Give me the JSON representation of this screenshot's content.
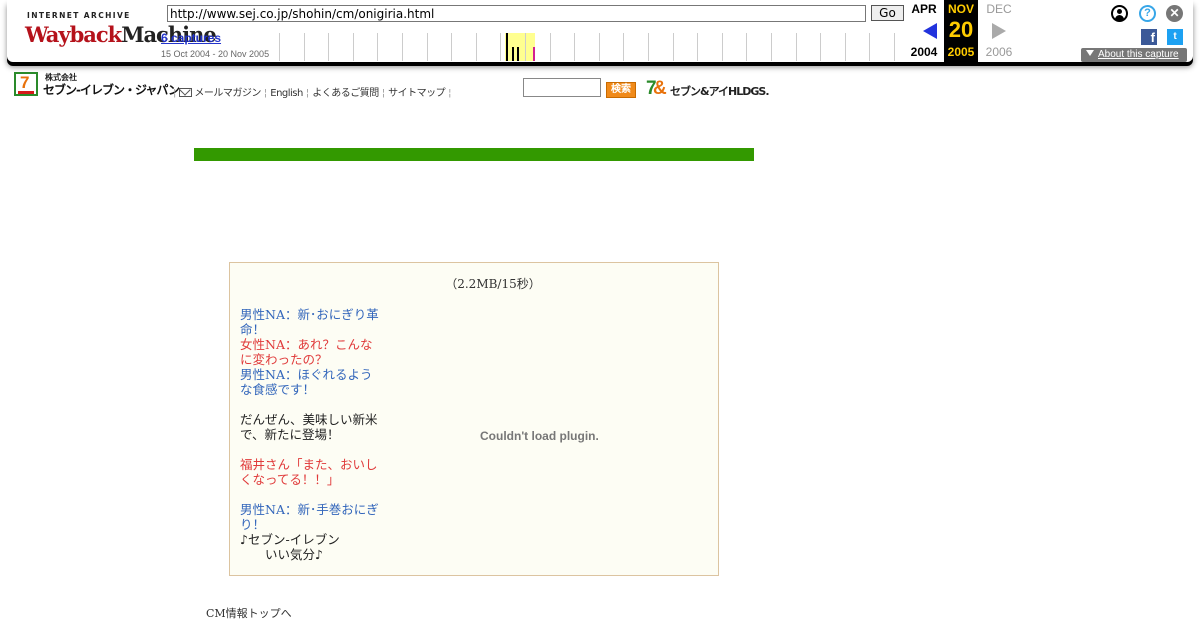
{
  "wayback": {
    "logo_top": "INTERNET ARCHIVE",
    "logo_word1": "Wayback",
    "logo_word2": "Machine",
    "url": "http://www.sej.co.jp/shohin/cm/onigiria.html",
    "go_label": "Go",
    "captures_label": "6 captures",
    "capture_range": "15 Oct 2004 - 20 Nov 2005",
    "prev_month": "APR",
    "prev_year": "2004",
    "cur_month": "NOV",
    "cur_day": "20",
    "cur_year": "2005",
    "next_month": "DEC",
    "next_year": "2006",
    "help_glyph": "?",
    "close_glyph": "✕",
    "facebook_glyph": "f",
    "twitter_glyph": "t",
    "about_label": "About this capture",
    "colors": {
      "accent": "#2233cc",
      "current_bg": "#000000",
      "current_fg": "#ffcc00"
    }
  },
  "site": {
    "logo_kk": "株式会社",
    "logo_name": "セブン-イレブン・ジャパン",
    "logo_seven": "7",
    "nav": [
      {
        "label": "メールマガジン"
      },
      {
        "label": "English"
      },
      {
        "label": "よくあるご質問"
      },
      {
        "label": "サイトマップ"
      }
    ],
    "search_placeholder": "",
    "search_button": "検索",
    "holdings_mark1": "7",
    "holdings_mark2": "&",
    "holdings_text": "セブン&アイHLDGS.",
    "colors": {
      "green": "#339900",
      "orange": "#f08a1a"
    }
  },
  "cm": {
    "size_note": "（2.2MB/15秒）",
    "script": [
      {
        "text": "男性NA：新･おにぎり革",
        "color": "blue"
      },
      {
        "text": "命！",
        "color": "blue"
      },
      {
        "text": "女性NA：あれ？こんな",
        "color": "red"
      },
      {
        "text": "に変わったの？",
        "color": "red"
      },
      {
        "text": "男性NA：ほぐれるよう",
        "color": "blue"
      },
      {
        "text": "な食感です！",
        "color": "blue"
      },
      {
        "text": "",
        "color": "gap"
      },
      {
        "text": "だんぜん、美味しい新米",
        "color": "black"
      },
      {
        "text": "で、新たに登場！",
        "color": "black"
      },
      {
        "text": "",
        "color": "gap"
      },
      {
        "text": "福井さん「また、おいし",
        "color": "red"
      },
      {
        "text": "くなってる！！」",
        "color": "red"
      },
      {
        "text": "",
        "color": "gap"
      },
      {
        "text": "男性NA：新･手巻おにぎ",
        "color": "blue"
      },
      {
        "text": "り！",
        "color": "blue"
      },
      {
        "text": "♪セブン-イレブン",
        "color": "black"
      },
      {
        "text": "　　いい気分♪",
        "color": "black"
      }
    ],
    "plugin_message": "Couldn't load plugin.",
    "top_link": "CM情報トップへ"
  }
}
